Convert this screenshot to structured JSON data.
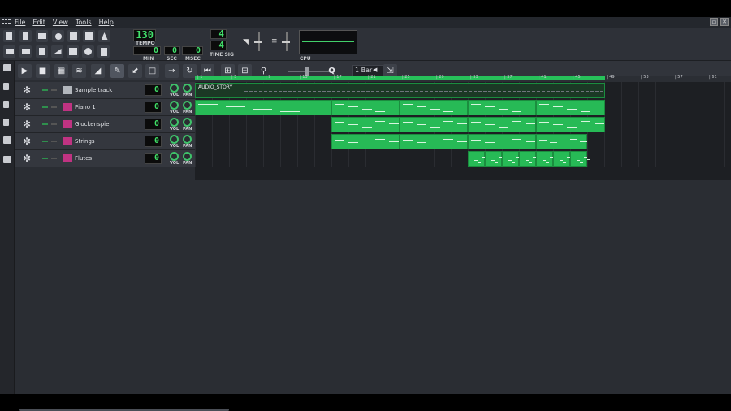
{
  "menu": [
    "File",
    "Edit",
    "View",
    "Tools",
    "Help"
  ],
  "lcd": {
    "tempo": "130",
    "tempo_label": "TEMPO",
    "min": "0",
    "min_label": "MIN",
    "sec": "0",
    "sec_label": "SEC",
    "msec": "0",
    "msec_label": "MSEC",
    "sig_top": "4",
    "sig_bottom": "4",
    "sig_label": "TIME SIG",
    "cpu_label": "CPU"
  },
  "editor": {
    "quantize": "1 Bar",
    "ruler_ticks": [
      "1",
      "5",
      "9",
      "13",
      "17",
      "21",
      "25",
      "29",
      "33",
      "37",
      "41",
      "45",
      "49",
      "53",
      "57",
      "61"
    ]
  },
  "tracks": [
    {
      "name": "Sample track",
      "volume": "0",
      "vol_label": "VOL",
      "pan_label": "PAN"
    },
    {
      "name": "Piano 1",
      "volume": "0",
      "vol_label": "VOL",
      "pan_label": "PAN"
    },
    {
      "name": "Glockenspiel",
      "volume": "0",
      "vol_label": "VOL",
      "pan_label": "PAN"
    },
    {
      "name": "Strings",
      "volume": "0",
      "vol_label": "VOL",
      "pan_label": "PAN"
    },
    {
      "name": "Flutes",
      "volume": "0",
      "vol_label": "VOL",
      "pan_label": "PAN"
    }
  ],
  "audio_clip": "AUDIO_STORY",
  "colors": {
    "accent": "#27ba56",
    "lcd": "#41e06b",
    "background": "#2a2d33"
  }
}
